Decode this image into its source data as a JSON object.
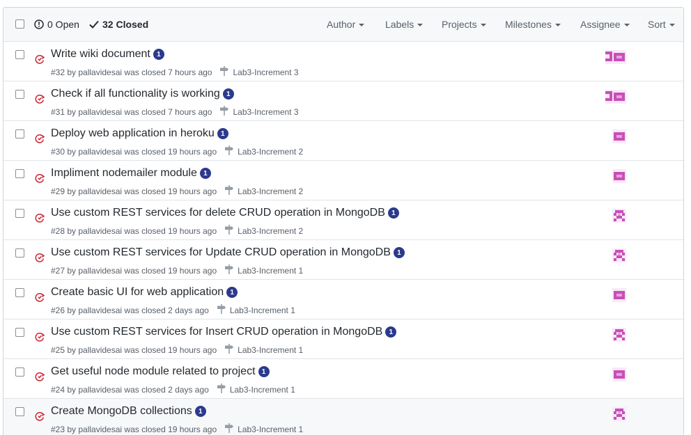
{
  "header": {
    "open_label": "0 Open",
    "closed_label": "32 Closed",
    "filters": [
      "Author",
      "Labels",
      "Projects",
      "Milestones",
      "Assignee",
      "Sort"
    ]
  },
  "colors": {
    "closed_icon": "#cb2431",
    "badge": "#2b3a8c",
    "avatar": "#c84fb8",
    "avatar_light": "#e8a3dd"
  },
  "issues": [
    {
      "title": "Write wiki document",
      "badge": "1",
      "meta": "#32 by pallavidesai was closed 7 hours ago",
      "milestone": "Lab3-Increment 3",
      "avatars": 2
    },
    {
      "title": "Check if all functionality is working",
      "badge": "1",
      "meta": "#31 by pallavidesai was closed 7 hours ago",
      "milestone": "Lab3-Increment 3",
      "avatars": 2
    },
    {
      "title": "Deploy web application in heroku",
      "badge": "1",
      "meta": "#30 by pallavidesai was closed 19 hours ago",
      "milestone": "Lab3-Increment 2",
      "avatars": 1
    },
    {
      "title": "Impliment nodemailer module",
      "badge": "1",
      "meta": "#29 by pallavidesai was closed 19 hours ago",
      "milestone": "Lab3-Increment 2",
      "avatars": 1
    },
    {
      "title": "Use custom REST services for delete CRUD operation in MongoDB",
      "badge": "1",
      "meta": "#28 by pallavidesai was closed 19 hours ago",
      "milestone": "Lab3-Increment 2",
      "avatars": 1
    },
    {
      "title": "Use custom REST services for Update CRUD operation in MongoDB",
      "badge": "1",
      "meta": "#27 by pallavidesai was closed 19 hours ago",
      "milestone": "Lab3-Increment 1",
      "avatars": 1
    },
    {
      "title": "Create basic UI for web application",
      "badge": "1",
      "meta": "#26 by pallavidesai was closed 2 days ago",
      "milestone": "Lab3-Increment 1",
      "avatars": 1
    },
    {
      "title": "Use custom REST services for Insert CRUD operation in MongoDB",
      "badge": "1",
      "meta": "#25 by pallavidesai was closed 19 hours ago",
      "milestone": "Lab3-Increment 1",
      "avatars": 1
    },
    {
      "title": "Get useful node module related to project",
      "badge": "1",
      "meta": "#24 by pallavidesai was closed 2 days ago",
      "milestone": "Lab3-Increment 1",
      "avatars": 1
    },
    {
      "title": "Create MongoDB collections",
      "badge": "1",
      "meta": "#23 by pallavidesai was closed 19 hours ago",
      "milestone": "Lab3-Increment 1",
      "avatars": 1
    }
  ]
}
